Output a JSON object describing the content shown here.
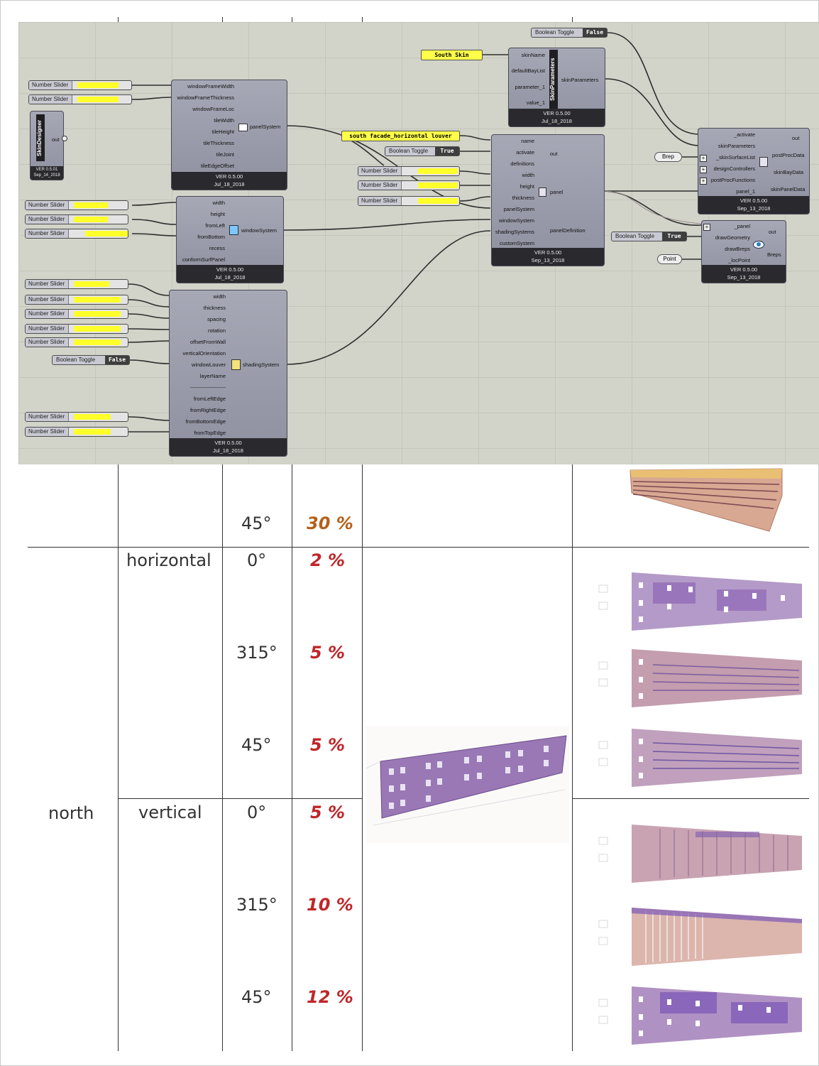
{
  "grasshopper": {
    "skin_designer": {
      "title": "SkinDesigner",
      "port_out": "out",
      "ver": "VER 0.5.01",
      "date": "Sep_14_2018"
    },
    "panel_system": {
      "inputs": [
        "windowFrameWidth",
        "windowFrameThickness",
        "windowFrameLoc",
        "tileWidth",
        "tileHeight",
        "tileThickness",
        "tileJoint",
        "tileEdgeOffset"
      ],
      "output": "panelSystem",
      "ver": "VER 0.5.00",
      "date": "Jul_18_2018"
    },
    "window_system": {
      "inputs": [
        "width",
        "height",
        "fromLeft",
        "fromBottom",
        "recess",
        "conformSurfPanel"
      ],
      "output": "windowSystem",
      "ver": "VER 0.5.00",
      "date": "Jul_18_2018"
    },
    "shading_system": {
      "inputs": [
        "width",
        "thickness",
        "spacing",
        "rotation",
        "offsetFromWall",
        "verticalOrientation",
        "windowLouver",
        "layerName",
        "--------------------",
        "fromLeftEdge",
        "fromRightEdge",
        "fromBottomEdge",
        "fromTopEdge"
      ],
      "output": "shadingSystem",
      "ver": "VER 0.5.00",
      "date": "Jul_18_2018"
    },
    "skin_parameters": {
      "title": "SkinParameters",
      "inputs": [
        "skinName",
        "defaultBayList",
        "parameter_1",
        "value_1"
      ],
      "output": "skinParameters",
      "ver": "VER 0.5.00",
      "date": "Jul_18_2018"
    },
    "panel": {
      "inputs": [
        "name",
        "activate",
        "definitions",
        "width",
        "height",
        "thickness",
        "panelSystem",
        "windowSystem",
        "shadingSystems",
        "customSystem"
      ],
      "outputs": [
        "out",
        "panel",
        "panelDefinition"
      ],
      "ver": "VER 0.5.00",
      "date": "Sep_13_2018"
    },
    "post_proc": {
      "inputs": [
        "_activate",
        "skinParameters",
        "_skinSurfaceList",
        "designControllers",
        "postProcFunctions",
        "panel_1"
      ],
      "outputs": [
        "out",
        "postProcData",
        "skinBayData",
        "skinPanelData"
      ],
      "ver": "VER 0.5.00",
      "date": "Sep_13_2018"
    },
    "draw": {
      "inputs": [
        "_panel",
        "drawGeometry",
        "drawBreps",
        "_locPoint"
      ],
      "outputs": [
        "out",
        "Breps"
      ],
      "ver": "VER 0.5.00",
      "date": "Sep_13_2018"
    },
    "number_slider_label": "Number Slider",
    "boolean_toggle_label": "Boolean Toggle",
    "toggle_false": "False",
    "toggle_true": "True",
    "panel_south_skin": "South Skin",
    "panel_louver": "south facade_horizontal louver",
    "param_brep": "Brep",
    "param_point": "Point"
  },
  "table": {
    "top_row": {
      "angle": "45°",
      "percent": "30 %"
    },
    "orientation": "north",
    "groups": [
      {
        "type": "horizontal",
        "rows": [
          {
            "angle": "0°",
            "percent": "2 %"
          },
          {
            "angle": "315°",
            "percent": "5 %"
          },
          {
            "angle": "45°",
            "percent": "5 %"
          }
        ]
      },
      {
        "type": "vertical",
        "rows": [
          {
            "angle": "0°",
            "percent": "5 %"
          },
          {
            "angle": "315°",
            "percent": "10 %"
          },
          {
            "angle": "45°",
            "percent": "12 %"
          }
        ]
      }
    ],
    "colors": {
      "percent_red": "#c0262a",
      "percent_orange": "#b5611c",
      "text": "#333333"
    }
  }
}
